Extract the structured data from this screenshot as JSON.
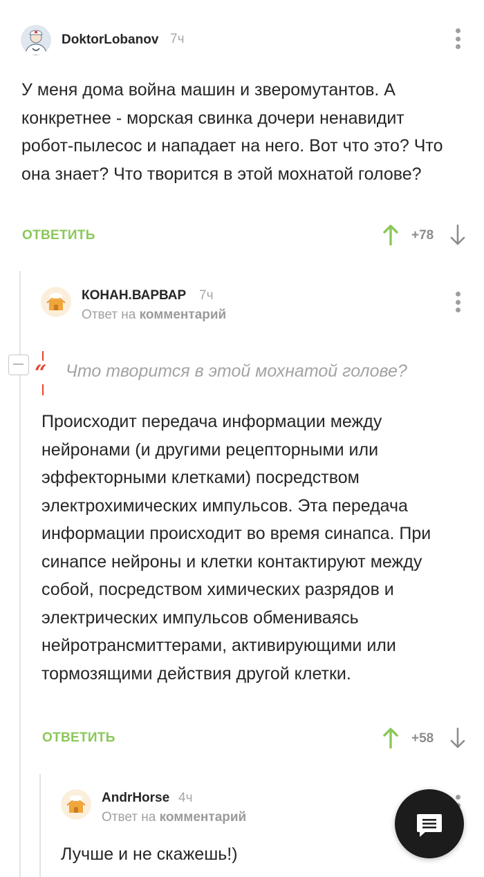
{
  "comments": [
    {
      "username": "DoktorLobanov",
      "time": "7ч",
      "text": "У меня дома война машин и зверомутантов. А конкретнее - морская свинка дочери ненавидит робот-пылесос и нападает на него. Вот что это? Что она знает? Что творится в этой мохнатой голове?",
      "reply_label": "ОТВЕТИТЬ",
      "score": "+78"
    },
    {
      "username": "КОНАН.ВАРВАР",
      "time": "7ч",
      "reply_to_prefix": "Ответ на",
      "reply_to_target": "комментарий",
      "quote": "Что творится в этой мохнатой голове?",
      "text": "Происходит передача информации между нейронами (и другими рецепторными или эффекторными клетками) посредством электрохимических импульсов. Эта передача информации происходит во время синапса. При синапсе нейроны и клетки контактируют между собой, посредством химических разрядов и электрических импульсов обмениваясь нейротрансмиттерами, активирующими или тормозящими действия другой клетки.",
      "reply_label": "ОТВЕТИТЬ",
      "score": "+58"
    },
    {
      "username": "AndrHorse",
      "time": "4ч",
      "reply_to_prefix": "Ответ на",
      "reply_to_target": "комментарий",
      "text": "Лучше и не скажешь!)"
    }
  ],
  "icons": {
    "collapse": "collapse-minus-icon",
    "quote": "quote-mark-icon",
    "upvote": "arrow-up-icon",
    "downvote": "arrow-down-icon",
    "more": "kebab-menu-icon",
    "fab": "comment-icon"
  },
  "colors": {
    "accent_green": "#8ac858",
    "quote_red": "#e8422f",
    "fab_bg": "#1c1c1c"
  }
}
